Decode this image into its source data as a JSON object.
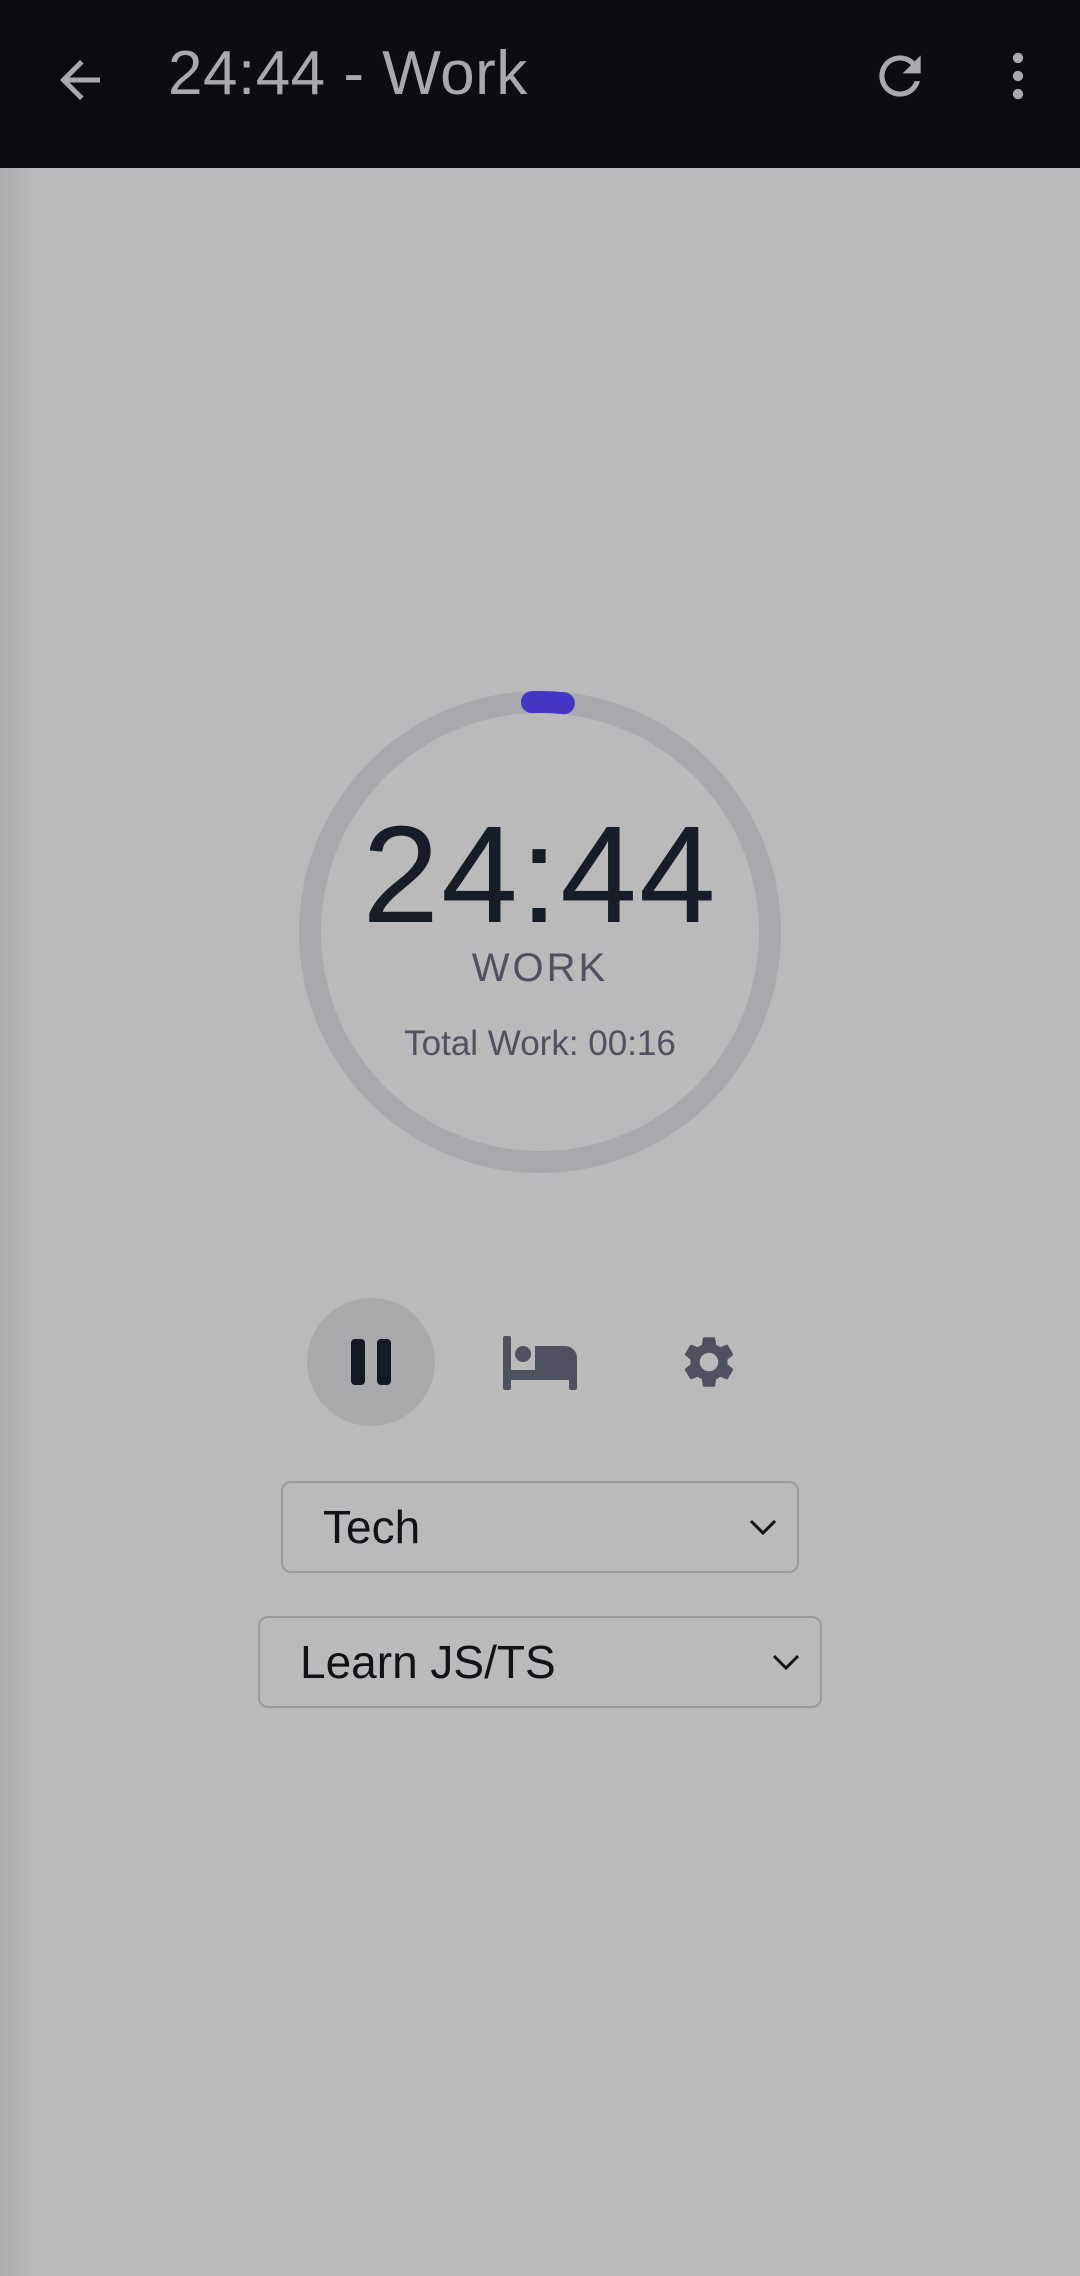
{
  "header": {
    "title": "24:44 - Work",
    "back_icon": "arrow-left-icon",
    "refresh_icon": "refresh-icon",
    "menu_icon": "more-vertical-icon"
  },
  "timer": {
    "time": "24:44",
    "phase": "WORK",
    "total_work": "Total Work: 00:16",
    "progress_elapsed_fraction": 0.011
  },
  "controls": {
    "pause_icon": "pause-icon",
    "break_icon": "bed-icon",
    "settings_icon": "gear-icon"
  },
  "selects": {
    "category": "Tech",
    "task": "Learn JS/TS"
  },
  "colors": {
    "topbar": "#0a0d12",
    "background": "#bababa",
    "accent": "#4336c4",
    "ring": "#a8a9ad"
  }
}
